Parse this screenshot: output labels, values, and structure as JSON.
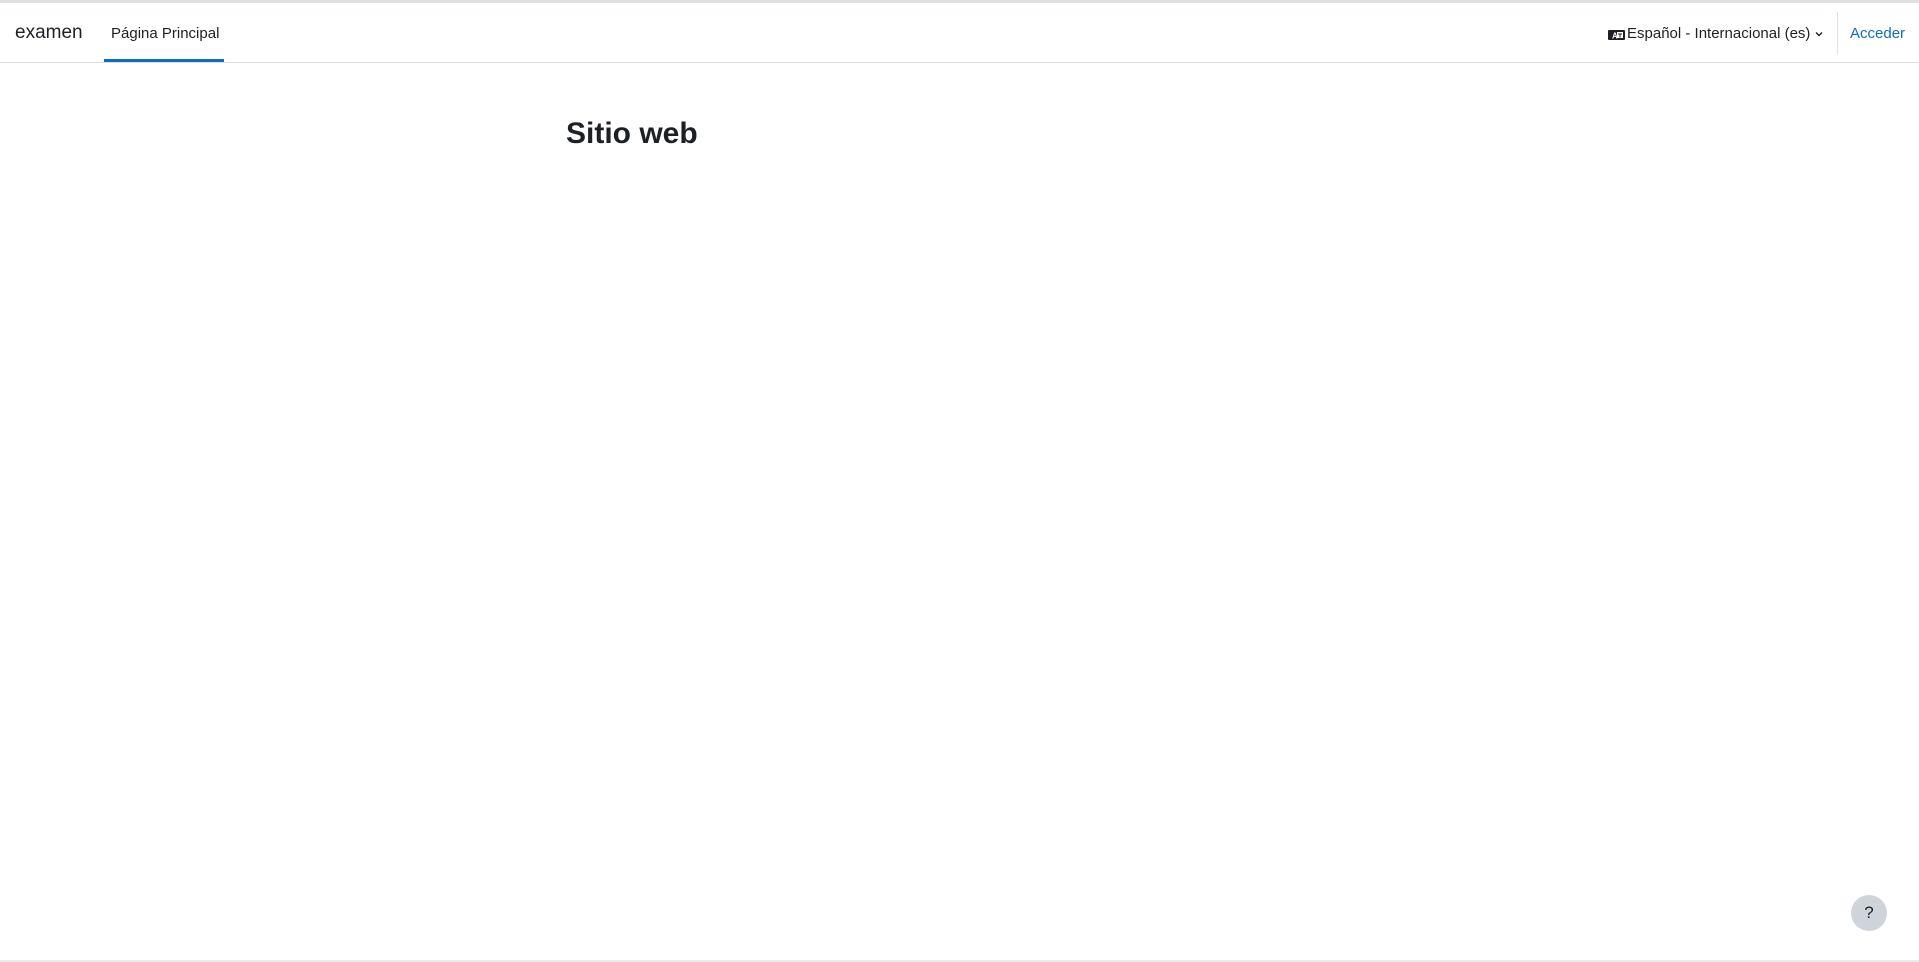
{
  "navbar": {
    "brand": "examen",
    "tabs": [
      {
        "label": "Página Principal",
        "active": true
      }
    ],
    "language": {
      "icon": "language-icon",
      "label": "Español - Internacional (es)",
      "chevron": "chevron-down-icon"
    },
    "login_label": "Acceder"
  },
  "main": {
    "title": "Sitio web"
  },
  "help": {
    "icon": "question-mark-icon",
    "label": "?"
  },
  "colors": {
    "accent": "#0f6cbf",
    "text": "#1d2125",
    "border": "#dee2e6",
    "help_bg": "#ced4da"
  }
}
